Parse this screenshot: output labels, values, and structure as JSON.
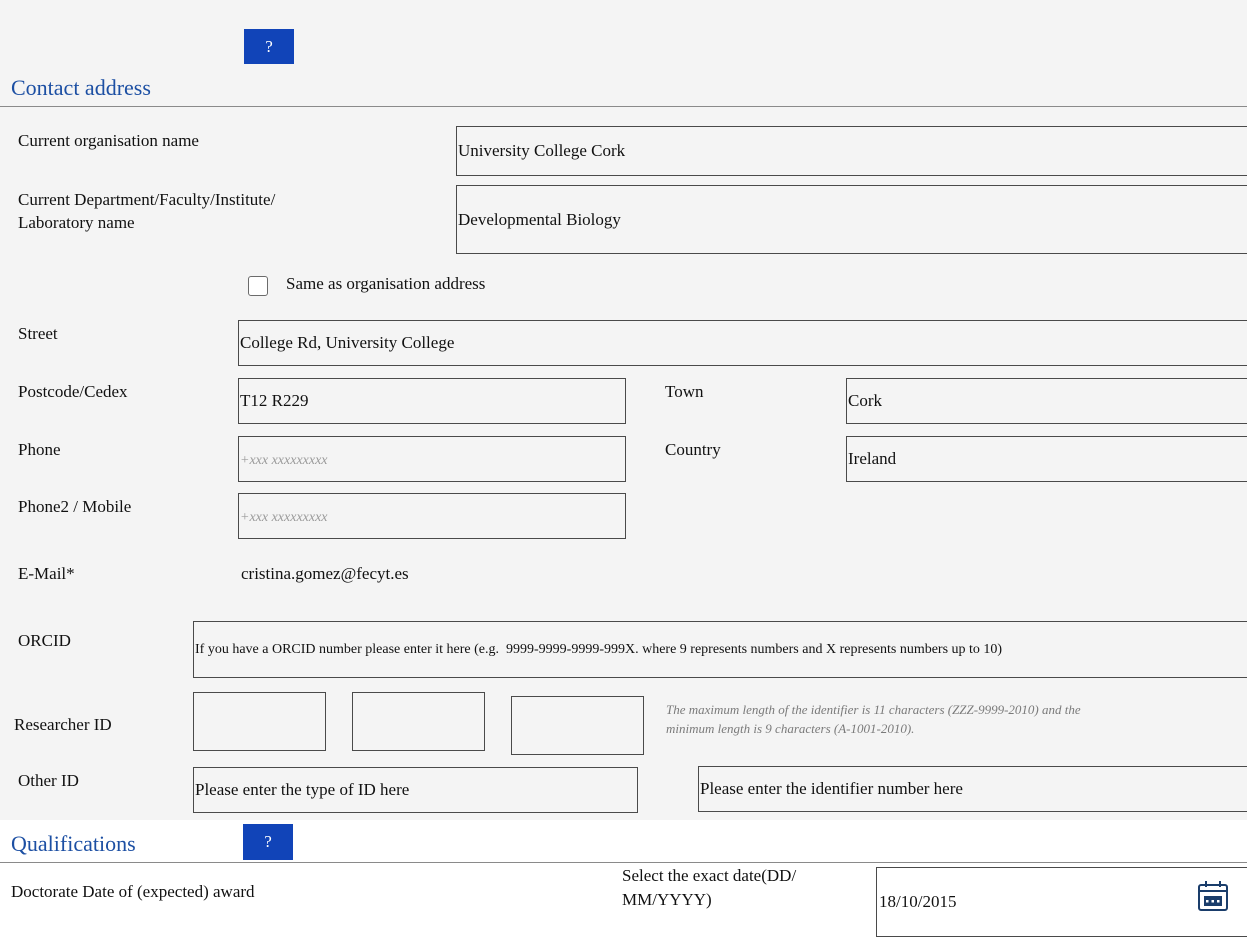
{
  "contact": {
    "title": "Contact address",
    "help_label": "?",
    "org_name_label": "Current organisation name",
    "org_name_value": "University College Cork",
    "dept_label_line1": "Current Department/Faculty/Institute/",
    "dept_label_line2": "Laboratory name",
    "dept_value": "Developmental Biology",
    "same_as_org_label": "Same as organisation address",
    "same_as_org_checked": false,
    "street_label": "Street",
    "street_value": "College Rd, University College",
    "postcode_label": "Postcode/Cedex",
    "postcode_value": "T12 R229",
    "town_label": "Town",
    "town_value": "Cork",
    "phone_label": "Phone",
    "phone_placeholder": "+xxx xxxxxxxxx",
    "country_label": "Country",
    "country_value": "Ireland",
    "phone2_label": "Phone2 / Mobile",
    "phone2_placeholder": "+xxx xxxxxxxxx",
    "email_label": "E-Mail*",
    "email_value": "cristina.gomez@fecyt.es",
    "orcid_label": "ORCID",
    "orcid_placeholder": "If you have a ORCID number please enter it here (e.g.  9999-9999-9999-999X. where 9 represents numbers and X represents numbers up to 10)",
    "researcher_id_label": "Researcher ID",
    "researcher_id_hint_line1": "The maximum length of the identifier is 11 characters (ZZZ-9999-2010) and the",
    "researcher_id_hint_line2": "minimum length is 9 characters (A-1001-2010).",
    "other_id_label": "Other ID",
    "other_id_type_placeholder": "Please enter the type of ID here",
    "other_id_number_placeholder": "Please enter the identifier number here"
  },
  "qualifications": {
    "title": "Qualifications",
    "help_label": "?",
    "doctorate_label": "Doctorate Date of (expected) award",
    "select_date_line1": "Select the exact date(DD/",
    "select_date_line2": "MM/YYYY)",
    "date_value": "18/10/2015"
  },
  "colors": {
    "accent": "#1144b8",
    "title": "#1c4fa3",
    "panel": "#f4f4f4"
  }
}
